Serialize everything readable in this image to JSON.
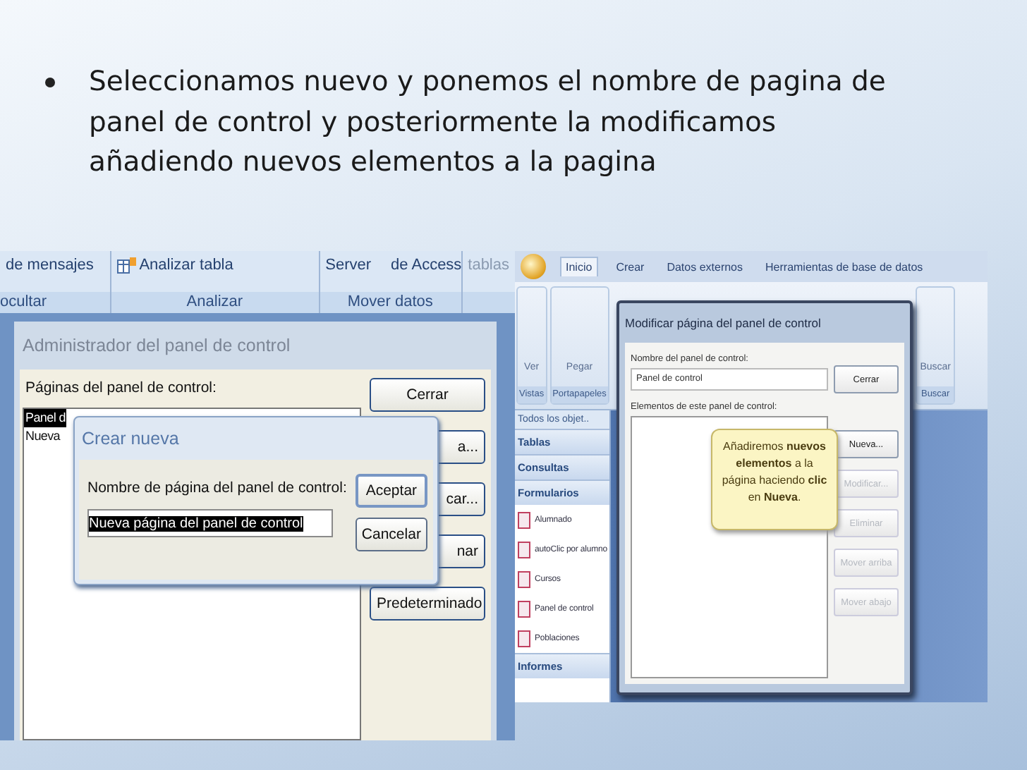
{
  "slide": {
    "bullet": "Seleccionamos nuevo y ponemos el nombre de pagina de panel de control y posteriormente la modificamos añadiendo nuevos elementos a la pagina"
  },
  "left_screenshot": {
    "ribbon": {
      "groups": [
        {
          "label": "ocultar",
          "items": [
            {
              "kind": "text",
              "label": "de mensajes"
            }
          ]
        },
        {
          "label": "Analizar",
          "items": [
            {
              "kind": "icon",
              "label": "Analizar tabla"
            }
          ]
        },
        {
          "label": "Mover datos",
          "items": [
            {
              "kind": "text",
              "label": "Server"
            },
            {
              "kind": "text",
              "label": "de Access"
            }
          ]
        },
        {
          "items": [
            {
              "kind": "text",
              "label": "tablas"
            }
          ]
        }
      ]
    },
    "dialog": {
      "title": "Administrador del panel de control",
      "list_label": "Páginas del panel de control:",
      "list": [
        {
          "label": "Panel d",
          "selected": true
        },
        {
          "label": "Nueva",
          "selected": false
        }
      ],
      "buttons": [
        "Cerrar",
        "a...",
        "car...",
        "nar",
        "Predeterminado"
      ]
    },
    "overlay": {
      "title": "Crear nueva",
      "label": "Nombre de página del panel de control:",
      "value": "Nueva página del panel de control",
      "value_selected": true,
      "buttons": [
        {
          "label": "Aceptar",
          "default": true
        },
        {
          "label": "Cancelar",
          "default": false
        }
      ]
    }
  },
  "right_screenshot": {
    "tabs": [
      {
        "label": "Inicio",
        "selected": true
      },
      {
        "label": "Crear",
        "selected": false
      },
      {
        "label": "Datos externos",
        "selected": false
      },
      {
        "label": "Herramientas de base de datos",
        "selected": false
      }
    ],
    "groups_left": [
      {
        "label": "Vistas",
        "items": [
          "Ver"
        ]
      },
      {
        "label": "Portapapeles",
        "items": [
          "Pegar"
        ]
      }
    ],
    "groups_right": [
      {
        "label": "Buscar",
        "items": [
          "Buscar"
        ]
      }
    ],
    "nav_pane": {
      "header": "Todos los objet..",
      "items": [
        {
          "kind": "section",
          "label": "Tablas"
        },
        {
          "kind": "section",
          "label": "Consultas"
        },
        {
          "kind": "section",
          "label": "Formularios"
        },
        {
          "kind": "object",
          "label": "Alumnado"
        },
        {
          "kind": "object",
          "label": "autoClic por alumno"
        },
        {
          "kind": "object",
          "label": "Cursos"
        },
        {
          "kind": "object",
          "label": "Panel de control"
        },
        {
          "kind": "object",
          "label": "Poblaciones"
        },
        {
          "kind": "section",
          "label": "Informes"
        }
      ]
    },
    "dialog": {
      "title": "Modificar página del panel de control",
      "name_label": "Nombre del panel de control:",
      "name_value": "Panel de control",
      "elements_label": "Elementos de este panel de control:",
      "buttons": [
        {
          "label": "Cerrar",
          "disabled": false
        },
        {
          "label": "Nueva...",
          "disabled": false
        },
        {
          "label": "Modificar...",
          "disabled": true
        },
        {
          "label": "Eliminar",
          "disabled": true
        },
        {
          "label": "Mover arriba",
          "disabled": true
        },
        {
          "label": "Mover abajo",
          "disabled": true
        }
      ],
      "callout": "Añadiremos **nuevos elementos** a la página haciendo **clic** en **Nueva**."
    }
  }
}
